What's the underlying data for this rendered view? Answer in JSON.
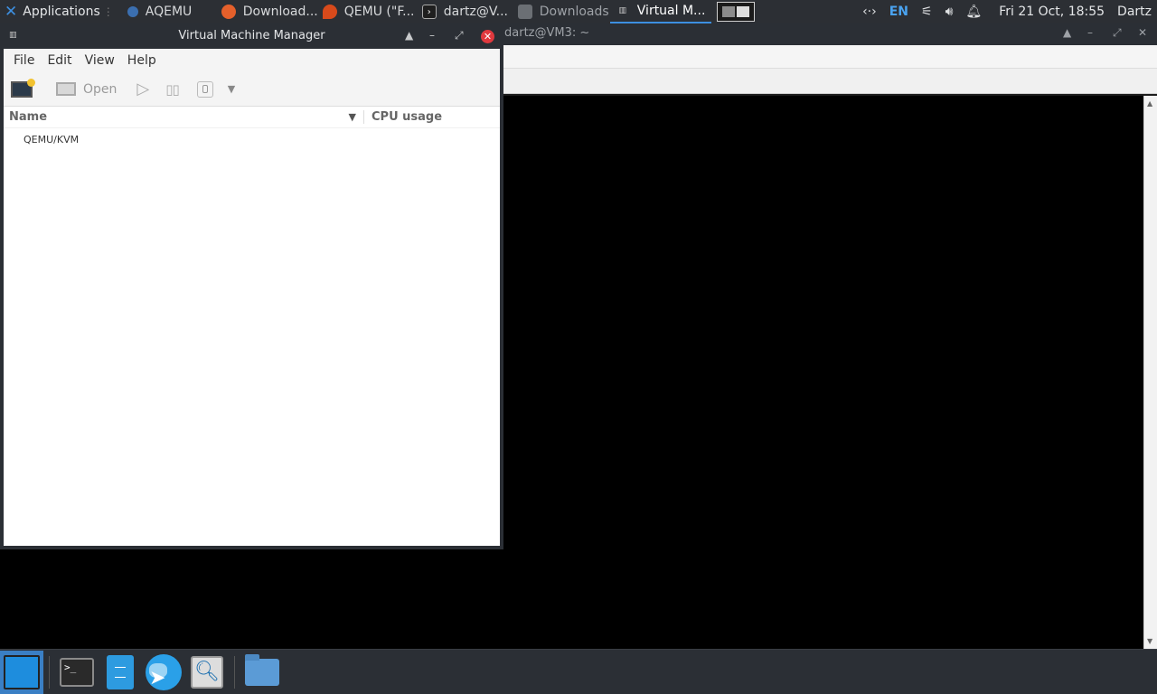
{
  "top_panel": {
    "applications_label": "Applications",
    "tasks": [
      {
        "label": "AQEMU",
        "icon": "aqemu-icon"
      },
      {
        "label": "Download...",
        "icon": "firefox-icon"
      },
      {
        "label": "QEMU (\"F...",
        "icon": "qemu-icon"
      },
      {
        "label": "dartz@V...",
        "icon": "terminal-icon"
      },
      {
        "label": "Downloads",
        "icon": "folder-icon"
      },
      {
        "label": "Virtual M...",
        "icon": "vmm-icon"
      }
    ],
    "tray": {
      "lang": "EN",
      "clock": "Fri 21 Oct, 18:55",
      "user": "Dartz"
    }
  },
  "bg_window": {
    "title": "dartz@VM3: ~"
  },
  "vmm": {
    "title": "Virtual Machine Manager",
    "menu": [
      "File",
      "Edit",
      "View",
      "Help"
    ],
    "toolbar": {
      "open_label": "Open"
    },
    "columns": {
      "name": "Name",
      "cpu": "CPU usage"
    },
    "rows": [
      {
        "name": "QEMU/KVM"
      }
    ]
  },
  "colors": {
    "accent": "#3d8fe0",
    "panel_bg": "#2c2f34",
    "close_button": "#e0393e"
  }
}
